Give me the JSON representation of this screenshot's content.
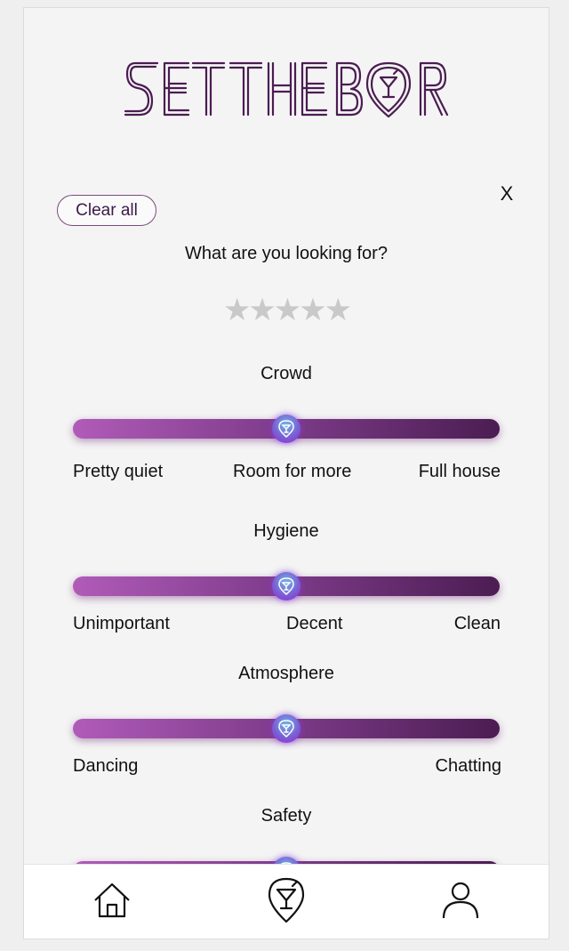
{
  "app": {
    "logo_text": "SET THE BAR"
  },
  "filter_panel": {
    "close_label": "X",
    "clear_all_label": "Clear all",
    "question": "What are you looking for?",
    "rating": {
      "value": 0,
      "max": 5,
      "star_glyph": "★"
    },
    "sliders": [
      {
        "title": "Crowd",
        "value": 0.5,
        "labels": [
          "Pretty quiet",
          "Room for more",
          "Full house"
        ]
      },
      {
        "title": "Hygiene",
        "value": 0.5,
        "labels": [
          "Unimportant",
          "Decent",
          "Clean"
        ]
      },
      {
        "title": "Atmosphere",
        "value": 0.5,
        "labels": [
          "Dancing",
          "Chatting"
        ]
      },
      {
        "title": "Safety",
        "value": 0.5,
        "labels": []
      }
    ]
  },
  "bottom_nav": {
    "items": [
      {
        "icon": "home-icon"
      },
      {
        "icon": "cocktail-pin-icon"
      },
      {
        "icon": "profile-icon"
      }
    ]
  },
  "colors": {
    "brand_purple": "#4b1d52",
    "slider_start": "#b05bb8",
    "slider_end": "#4b1d52",
    "star_inactive": "#c9c9c9"
  }
}
